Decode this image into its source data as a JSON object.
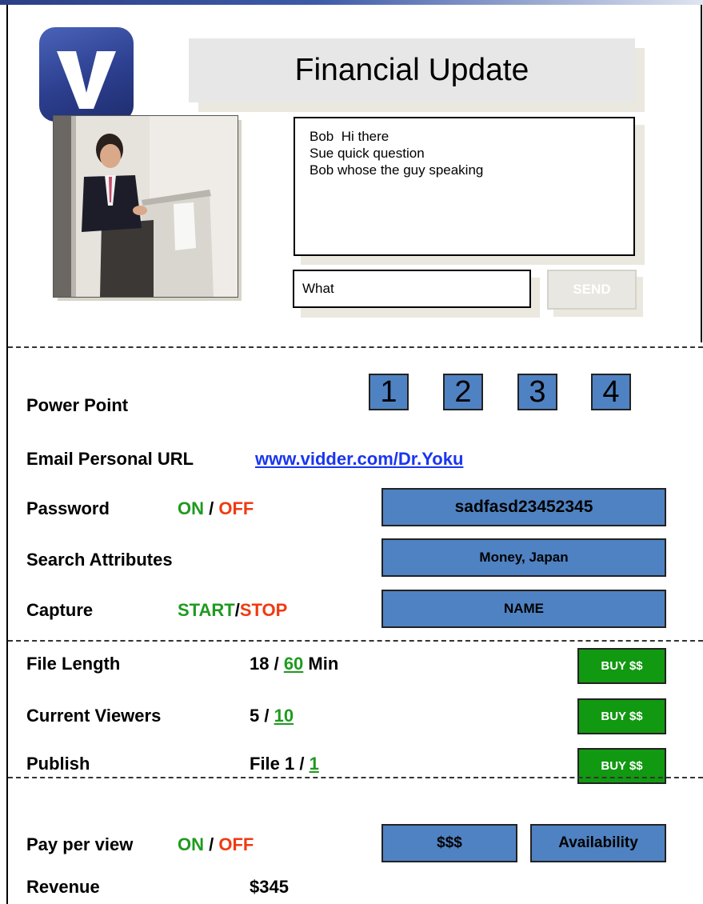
{
  "app": {
    "logo_letter": "V",
    "title": "Financial Update"
  },
  "chat": {
    "messages": [
      {
        "text": "Bob  Hi there"
      },
      {
        "text": "Sue quick question"
      },
      {
        "text": "Bob whose the guy speaking"
      }
    ],
    "input_value": "What",
    "send_label": "SEND"
  },
  "powerpoint": {
    "label": "Power Point",
    "slides": [
      "1",
      "2",
      "3",
      "4"
    ]
  },
  "email": {
    "label": "Email Personal URL",
    "url": "www.vidder.com/Dr.Yoku"
  },
  "password": {
    "label": "Password",
    "on": "ON",
    "sep": "/",
    "off": "OFF",
    "value": "sadfasd23452345"
  },
  "search": {
    "label": "Search Attributes",
    "value": "Money, Japan"
  },
  "capture": {
    "label": "Capture",
    "start": "START",
    "sep": "/",
    "stop": "STOP",
    "name_button": "NAME"
  },
  "file_length": {
    "label": "File Length",
    "used": "18 / ",
    "max": "60",
    "unit": " Min",
    "buy": "BUY $$"
  },
  "viewers": {
    "label": "Current Viewers",
    "current": "5 / ",
    "max": "10",
    "buy": "BUY $$"
  },
  "publish": {
    "label": "Publish",
    "current": "File 1 / ",
    "max": "1",
    "buy": "BUY $$"
  },
  "ppv": {
    "label": "Pay per view",
    "on": "ON",
    "sep": "/",
    "off": "OFF",
    "price_button": "$$$",
    "availability_button": "Availability"
  },
  "revenue": {
    "label": "Revenue",
    "value": "$345"
  },
  "colors": {
    "button_blue": "#4f82c2",
    "buy_green": "#119911",
    "on_green": "#1f9a1f",
    "off_red": "#f03a12",
    "link_blue": "#1a35f0"
  }
}
